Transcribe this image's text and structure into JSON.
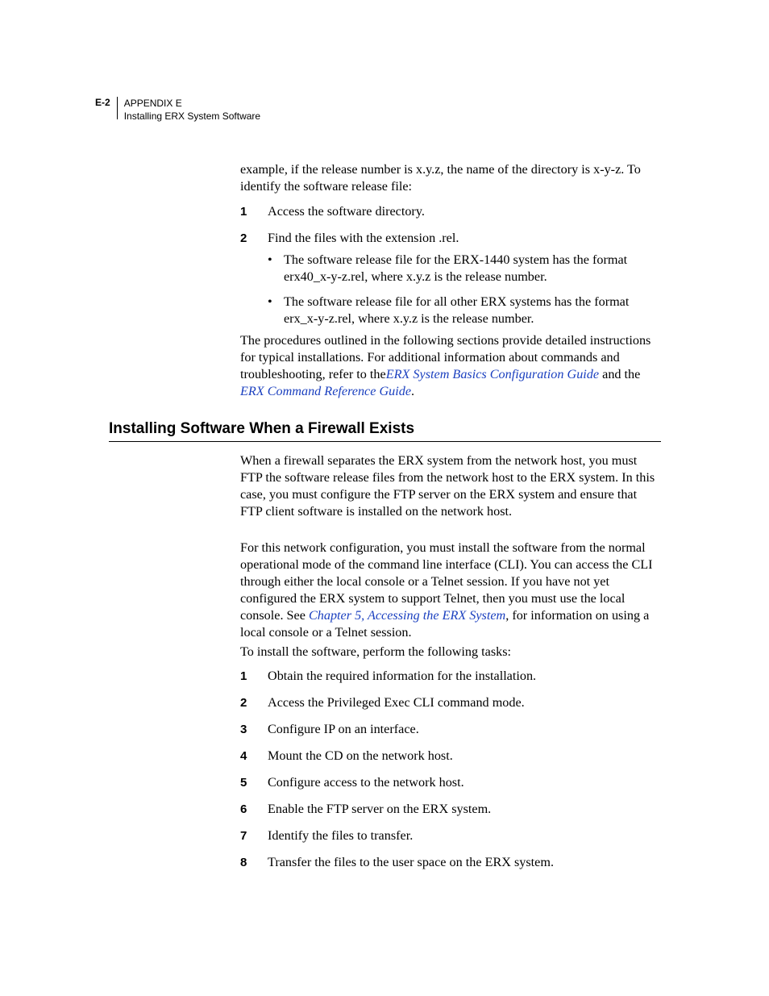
{
  "header": {
    "page_num": "E-2",
    "line1": "APPENDIX E",
    "line2": "Installing ERX System Software"
  },
  "intro": "example, if the release number is x.y.z, the name of the directory is x-y-z. To identify the software release file:",
  "list1": [
    "Access the software directory.",
    "Find the files with the extension .rel."
  ],
  "bullets": [
    "The software release file for the ERX-1440 system has the format erx40_x-y-z.rel, where x.y.z is the release number.",
    "The software release file for all other ERX systems has the format erx_x-y-z.rel, where x.y.z is the release number."
  ],
  "procs": {
    "pre": "The procedures outlined in the following sections provide detailed instructions for typical installations. For additional information about commands and troubleshooting, refer to the",
    "link1": "ERX System Basics Configuration Guide",
    "mid": " and the ",
    "link2": "ERX Command Reference Guide",
    "post": "."
  },
  "heading": "Installing Software When a Firewall Exists",
  "sec_p1": "When a firewall separates the ERX system from the network host, you must FTP the software release files from the network host to the ERX system. In this case, you must configure the FTP server on the ERX system and ensure that FTP client software is installed on the network host.",
  "sec_p2": {
    "pre": "For this network configuration, you must install the software from the normal operational mode of the command line interface (CLI). You can access the CLI through either the local console or a Telnet session. If you have not yet configured the ERX system to support Telnet, then you must use the local console. See ",
    "link": "Chapter 5, Accessing the ERX System",
    "post": ", for information on using a local console or a Telnet session."
  },
  "sec_p3": "To install the software, perform the following tasks:",
  "list2": [
    "Obtain the required information for the installation.",
    "Access the Privileged Exec CLI command mode.",
    "Configure IP on an interface.",
    "Mount the CD on the network host.",
    "Configure access to the network host.",
    "Enable the FTP server on the ERX system.",
    "Identify the files to transfer.",
    "Transfer the files to the user space on the ERX system."
  ]
}
